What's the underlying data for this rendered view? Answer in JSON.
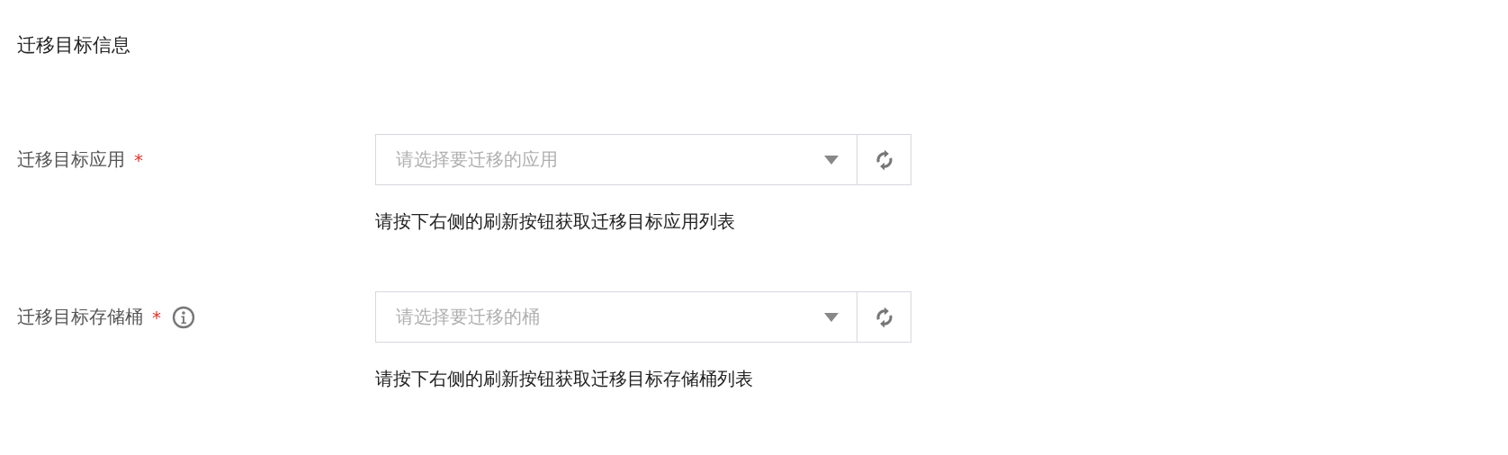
{
  "section_title": "迁移目标信息",
  "fields": [
    {
      "label": "迁移目标应用",
      "required_mark": "*",
      "info": false,
      "placeholder": "请选择要迁移的应用",
      "hint": "请按下右侧的刷新按钮获取迁移目标应用列表"
    },
    {
      "label": "迁移目标存储桶",
      "required_mark": "*",
      "info": true,
      "placeholder": "请选择要迁移的桶",
      "hint": "请按下右侧的刷新按钮获取迁移目标存储桶列表"
    }
  ]
}
